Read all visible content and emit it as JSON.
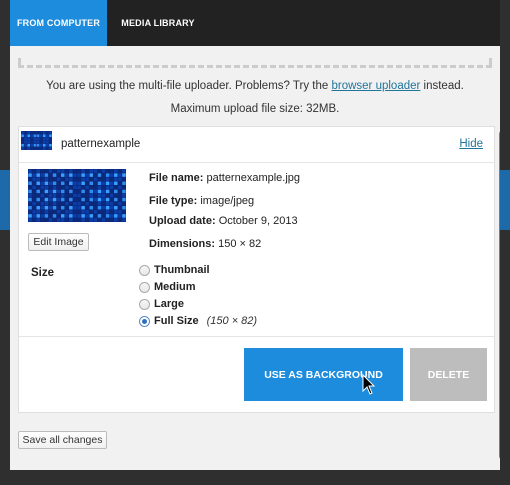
{
  "tabs": [
    {
      "label": "FROM COMPUTER",
      "active": true
    },
    {
      "label": "MEDIA LIBRARY",
      "active": false
    }
  ],
  "notice": {
    "prefix": "You are using the multi-file uploader. Problems? Try the ",
    "link": "browser uploader",
    "suffix": " instead.",
    "max_size": "Maximum upload file size: 32MB."
  },
  "item": {
    "filename": "patternexample",
    "hide_label": "Hide",
    "edit_label": "Edit Image",
    "meta": {
      "file_name_label": "File name:",
      "file_name": "patternexample.jpg",
      "file_type_label": "File type:",
      "file_type": "image/jpeg",
      "upload_date_label": "Upload date:",
      "upload_date": "October 9, 2013",
      "dimensions_label": "Dimensions:",
      "dimensions": "150 × 82"
    },
    "size_label": "Size",
    "size_options": [
      {
        "label": "Thumbnail",
        "checked": false
      },
      {
        "label": "Medium",
        "checked": false
      },
      {
        "label": "Large",
        "checked": false
      },
      {
        "label": "Full Size",
        "checked": true,
        "note": "(150 × 82)"
      }
    ],
    "use_bg_label": "USE AS BACKGROUND",
    "delete_label": "DELETE"
  },
  "save_all_label": "Save all changes",
  "colors": {
    "accent": "#1e8cdd",
    "link": "#21759b",
    "delete_gray": "#bdbdbd",
    "tabbar": "#222222"
  },
  "icons": {
    "cursor": "pointer-arrow-icon",
    "thumbnail": "pattern-image"
  }
}
